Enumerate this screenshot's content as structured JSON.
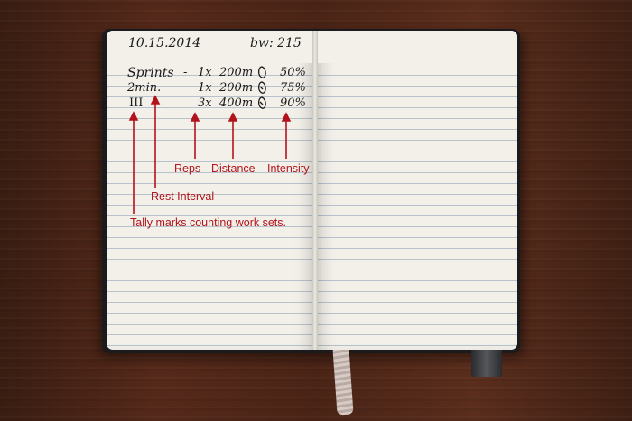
{
  "notebook": {
    "date": "10.15.2014",
    "bodyweight": "bw: 215",
    "rows": [
      {
        "label": "Sprints",
        "dash": "-",
        "sets": "1x",
        "distance": "200m",
        "intensity": "50%"
      },
      {
        "label": "2min.",
        "dash": "",
        "sets": "1x",
        "distance": "200m",
        "intensity": "75%"
      },
      {
        "label": "III",
        "dash": "",
        "sets": "3x",
        "distance": "400m",
        "intensity": "90%"
      }
    ]
  },
  "annotations": {
    "reps": "Reps",
    "distance": "Distance",
    "intensity": "Intensity",
    "rest_interval": "Rest Interval",
    "tally": "Tally marks counting work sets."
  },
  "colors": {
    "annotation": "#b3131b",
    "ink": "#1a1a1a",
    "paper": "#f2f0e9",
    "table_wood": "#4a2416"
  }
}
